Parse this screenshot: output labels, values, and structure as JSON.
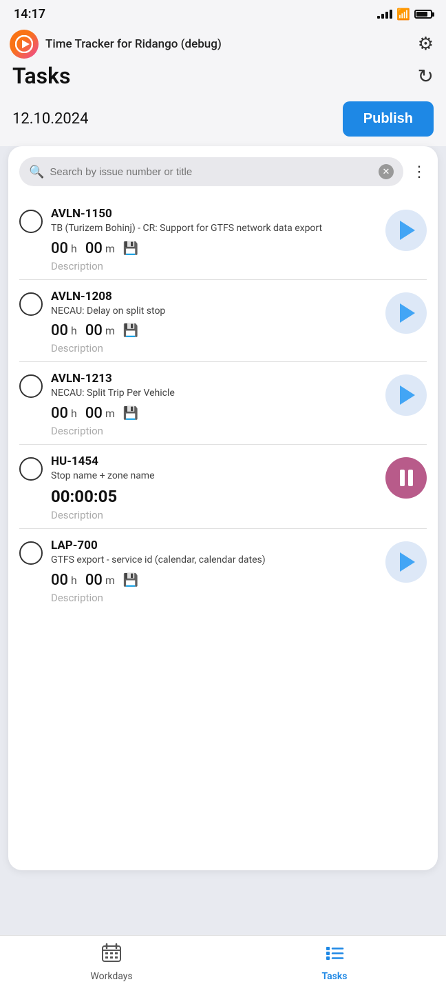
{
  "statusBar": {
    "time": "14:17"
  },
  "appBar": {
    "title": "Time Tracker for Ridango (debug)"
  },
  "pageHeader": {
    "title": "Tasks"
  },
  "dateRow": {
    "date": "12.10.2024",
    "publishLabel": "Publish"
  },
  "search": {
    "placeholder": "Search by issue number or title"
  },
  "tasks": [
    {
      "id": "AVLN-1150",
      "description": "TB (Turizem Bohinj) - CR: Support for GTFS network data export",
      "hoursVal": "00",
      "hoursUnit": "h",
      "minutesVal": "00",
      "minutesUnit": "m",
      "descriptionPlaceholder": "Description",
      "timerActive": false,
      "activeTimer": ""
    },
    {
      "id": "AVLN-1208",
      "description": "NECAU: Delay on split stop",
      "hoursVal": "00",
      "hoursUnit": "h",
      "minutesVal": "00",
      "minutesUnit": "m",
      "descriptionPlaceholder": "Description",
      "timerActive": false,
      "activeTimer": ""
    },
    {
      "id": "AVLN-1213",
      "description": "NECAU: Split Trip Per Vehicle",
      "hoursVal": "00",
      "hoursUnit": "h",
      "minutesVal": "00",
      "minutesUnit": "m",
      "descriptionPlaceholder": "Description",
      "timerActive": false,
      "activeTimer": ""
    },
    {
      "id": "HU-1454",
      "description": "Stop name + zone name",
      "hoursVal": "",
      "hoursUnit": "",
      "minutesVal": "",
      "minutesUnit": "",
      "descriptionPlaceholder": "Description",
      "timerActive": true,
      "activeTimer": "00:00:05"
    },
    {
      "id": "LAP-700",
      "description": "GTFS export - service id (calendar, calendar dates)",
      "hoursVal": "00",
      "hoursUnit": "h",
      "minutesVal": "00",
      "minutesUnit": "m",
      "descriptionPlaceholder": "Description",
      "timerActive": false,
      "activeTimer": ""
    }
  ],
  "bottomNav": [
    {
      "label": "Workdays",
      "active": false,
      "icon": "📅"
    },
    {
      "label": "Tasks",
      "active": true,
      "icon": "☰"
    }
  ]
}
